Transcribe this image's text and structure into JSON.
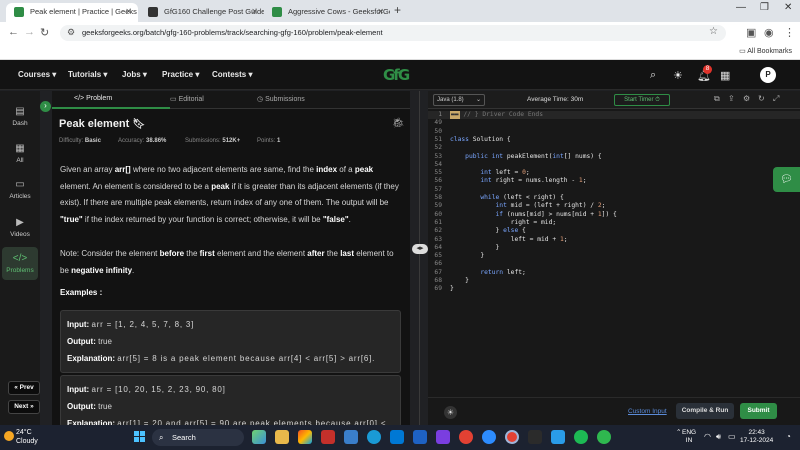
{
  "browser": {
    "tabs": [
      {
        "title": "Peak element | Practice | Geeks",
        "active": true,
        "favicon_color": "#2f8d46"
      },
      {
        "title": "GfG160 Challenge Post Guide",
        "active": false,
        "favicon_color": "#333333"
      },
      {
        "title": "Aggressive Cows - GeeksforGee",
        "active": false,
        "favicon_color": "#2f8d46"
      }
    ],
    "new_tab": "+",
    "url": "geeksforgeeks.org/batch/gfg-160-problems/track/searching-gfg-160/problem/peak-element",
    "bookmarks_label": "All Bookmarks"
  },
  "site_header": {
    "menu": [
      "Courses ▾",
      "Tutorials ▾",
      "Jobs ▾",
      "Practice ▾",
      "Contests ▾"
    ],
    "logo": "GfG",
    "notification_count": "8",
    "avatar_initial": "P"
  },
  "sidebar": {
    "items": [
      {
        "label": "Dash",
        "icon": "dashboard-icon"
      },
      {
        "label": "All",
        "icon": "grid-icon"
      },
      {
        "label": "Articles",
        "icon": "article-icon"
      },
      {
        "label": "Videos",
        "icon": "video-icon"
      },
      {
        "label": "Problems",
        "icon": "code-icon",
        "active": true
      }
    ],
    "prev_label": "« Prev",
    "next_label": "Next »"
  },
  "problem_panel": {
    "tabs": [
      "Problem",
      "Editorial",
      "Submissions"
    ],
    "title": "Peak element",
    "meta": {
      "difficulty_label": "Difficulty:",
      "difficulty": "Basic",
      "accuracy_label": "Accuracy:",
      "accuracy": "38.86%",
      "submissions_label": "Submissions:",
      "submissions": "512K+",
      "points_label": "Points:",
      "points": "1"
    },
    "description": [
      "Given an array ",
      "arr[]",
      " where no two adjacent elements are same, find the ",
      "index",
      " of a ",
      "peak",
      " element. An element is considered to be a ",
      "peak",
      " if it is greater than its adjacent elements (if they exist). If there are multiple peak elements, return index of any one of them. The output will be ",
      "\"true\"",
      " if the index returned by your function is correct; otherwise, it will be ",
      "\"false\"",
      "."
    ],
    "note": [
      "Note: Consider the element ",
      "before",
      " the ",
      "first",
      " element and the element ",
      "after",
      " the ",
      "last",
      " element to be ",
      "negative infinity",
      "."
    ],
    "examples_heading": "Examples :",
    "examples": [
      {
        "input_label": "Input:",
        "input": "arr = [1, 2, 4, 5, 7, 8, 3]",
        "output_label": "Output:",
        "output": "true",
        "explanation_label": "Explanation:",
        "explanation": "arr[5] = 8 is a peak element because arr[4] < arr[5] > arr[6]."
      },
      {
        "input_label": "Input:",
        "input": "arr = [10, 20, 15, 2, 23, 90, 80]",
        "output_label": "Output:",
        "output": "true",
        "explanation_label": "Explanation:",
        "explanation": "arr[1] = 20 and arr[5] = 90 are peak elements because arr[0] <"
      }
    ]
  },
  "editor": {
    "language": "Java (1.8)",
    "average_time": "Average Time: 30m",
    "timer_label": "Start Timer ⏱",
    "lines": [
      {
        "n": "1",
        "html": "<span class=\"cmt-badge\">▬▬</span><span class=\"cmt\"> // } Driver Code Ends</span>",
        "hl": true
      },
      {
        "n": "49",
        "html": ""
      },
      {
        "n": "50",
        "html": ""
      },
      {
        "n": "51",
        "html": "<span class=\"k\">class</span> Solution {"
      },
      {
        "n": "52",
        "html": ""
      },
      {
        "n": "53",
        "html": "    <span class=\"k\">public int</span> peakElement(<span class=\"k\">int</span>[] nums) {"
      },
      {
        "n": "54",
        "html": ""
      },
      {
        "n": "55",
        "html": "        <span class=\"k\">int</span> left = <span class=\"n\">0</span>;"
      },
      {
        "n": "56",
        "html": "        <span class=\"k\">int</span> right = nums.length - <span class=\"n\">1</span>;"
      },
      {
        "n": "57",
        "html": ""
      },
      {
        "n": "58",
        "html": "        <span class=\"k\">while</span> (left &lt; right) {"
      },
      {
        "n": "59",
        "html": "            <span class=\"k\">int</span> mid = (left + right) / <span class=\"n\">2</span>;"
      },
      {
        "n": "60",
        "html": "            <span class=\"k\">if</span> (nums[mid] &gt; nums[mid + <span class=\"n\">1</span>]) {"
      },
      {
        "n": "61",
        "html": "                right = mid;"
      },
      {
        "n": "62",
        "html": "            } <span class=\"k\">else</span> {"
      },
      {
        "n": "63",
        "html": "                left = mid + <span class=\"n\">1</span>;"
      },
      {
        "n": "64",
        "html": "            }"
      },
      {
        "n": "65",
        "html": "        }"
      },
      {
        "n": "66",
        "html": ""
      },
      {
        "n": "67",
        "html": "        <span class=\"k\">return</span> left;"
      },
      {
        "n": "68",
        "html": "    }"
      },
      {
        "n": "69",
        "html": "}"
      }
    ],
    "custom_input": "Custom Input",
    "compile_run": "Compile & Run",
    "submit": "Submit"
  },
  "taskbar": {
    "temperature": "24°C",
    "weather": "Cloudy",
    "search": "Search",
    "lang_line1": "ENG",
    "lang_line2": "IN",
    "time": "22:43",
    "date": "17-12-2024"
  }
}
